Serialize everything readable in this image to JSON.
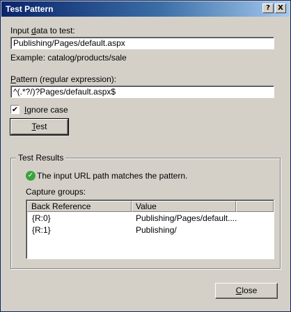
{
  "window": {
    "title": "Test Pattern"
  },
  "titlebar_buttons": {
    "help_label": "?",
    "close_label": "X"
  },
  "input": {
    "label_underlined": "d",
    "label_pre": "Input ",
    "label_post": "ata to test:",
    "value": "Publishing/Pages/default.aspx",
    "example": "Example: catalog/products/sale"
  },
  "pattern": {
    "label_underlined": "P",
    "label_post": "attern (regular expression):",
    "value": "^(.*?/)?Pages/default.aspx$"
  },
  "ignore_case": {
    "checked": true,
    "check_glyph": "✔",
    "label_underlined": "I",
    "label_post": "gnore case"
  },
  "test_button": {
    "label_underlined": "T",
    "label_post": "est"
  },
  "results": {
    "group_title": "Test Results",
    "status_icon": "check-icon",
    "status_glyph": "✓",
    "status_text": "The input URL path matches the pattern.",
    "capture_groups_label": "Capture groups:",
    "columns": [
      "Back Reference",
      "Value"
    ],
    "rows": [
      {
        "ref": "{R:0}",
        "value": "Publishing/Pages/default...."
      },
      {
        "ref": "{R:1}",
        "value": "Publishing/"
      }
    ]
  },
  "close_button": {
    "label_underlined": "C",
    "label_post": "lose"
  }
}
